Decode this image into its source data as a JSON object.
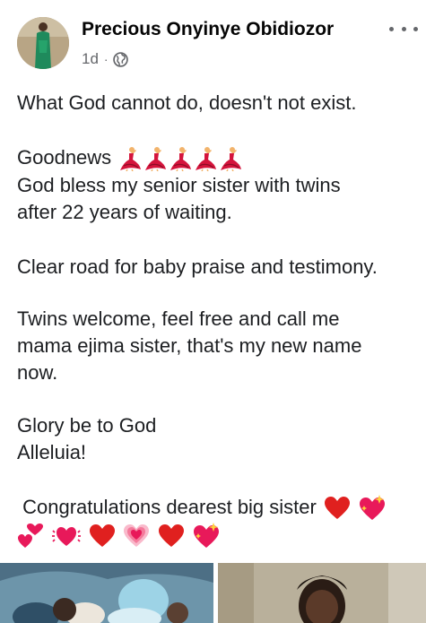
{
  "author": {
    "name": "Precious Onyinye Obidiozor",
    "time": "1d",
    "separator": "·",
    "privacy_icon": "globe-icon"
  },
  "header": {
    "more_icon": "more-horizontal-icon"
  },
  "post": {
    "line1": "What God cannot do, doesn't not exist.",
    "line2": "Goodnews",
    "line3": "  God bless my senior  sister with twins",
    "line4": "after 22 years of waiting.",
    "line5": "Clear road for baby praise and testimony.",
    "line6": "Twins welcome,  feel free and call me",
    "line7": "mama ejima sister, that's my new name",
    "line8": "now.",
    "line9": "Glory be to God",
    "line10": "Alleluia!",
    "line11": " Congratulations dearest big sister"
  },
  "emojis": {
    "dancer_count": 5,
    "dancer_icon": "dancing-woman-emoji",
    "line11_icons": [
      "red-heart-emoji",
      "sparkling-heart-emoji"
    ],
    "line12_icons": [
      "two-hearts-emoji",
      "beating-heart-emoji",
      "red-heart-emoji",
      "growing-heart-emoji",
      "red-heart-emoji",
      "sparkling-heart-emoji"
    ]
  },
  "colors": {
    "text": "#1c1e21",
    "meta": "#65676b",
    "heart_red": "#e0201f",
    "sparkle_heart": "#e8195a",
    "dancer_red": "#d4143c"
  }
}
